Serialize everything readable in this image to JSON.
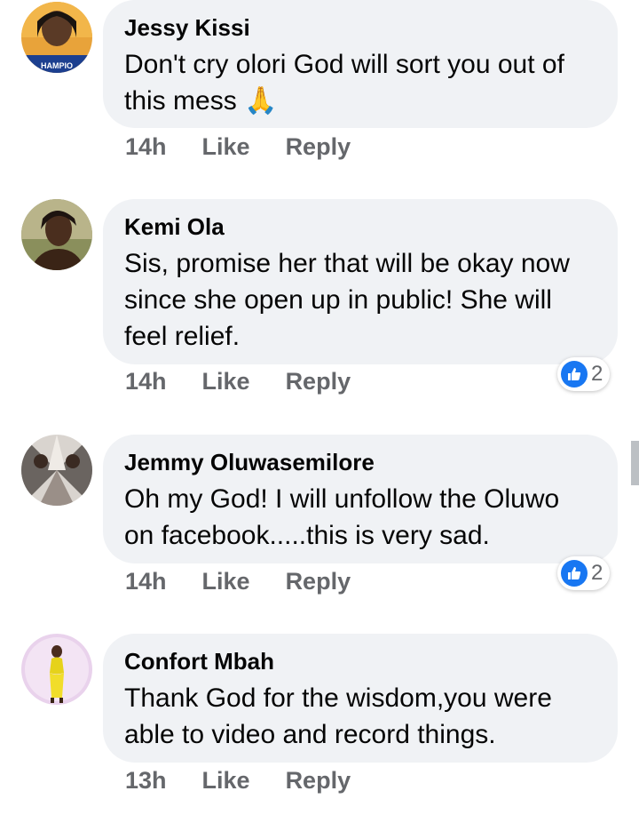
{
  "comments": [
    {
      "author": "Jessy Kissi",
      "text_lines": [
        "Don't cry olori God will sort you out of",
        "this mess 🙏"
      ],
      "time": "14h",
      "like_label": "Like",
      "reply_label": "Reply",
      "reactions": null,
      "avatar_badge_text": "HAMPIO"
    },
    {
      "author": "Kemi Ola",
      "text_lines": [
        "Sis, promise her that will be okay now",
        "since she open up in public! She will",
        "feel relief."
      ],
      "time": "14h",
      "like_label": "Like",
      "reply_label": "Reply",
      "reactions": "2"
    },
    {
      "author": "Jemmy Oluwasemilore",
      "text_lines": [
        "Oh my God! I will unfollow the Oluwo",
        "on facebook.....this is very sad."
      ],
      "time": "14h",
      "like_label": "Like",
      "reply_label": "Reply",
      "reactions": "2"
    },
    {
      "author": "Confort Mbah",
      "text_lines": [
        "Thank God for the wisdom,you were",
        "able to video and record things."
      ],
      "time": "13h",
      "like_label": "Like",
      "reply_label": "Reply",
      "reactions": null
    }
  ],
  "colors": {
    "bubble": "#f0f2f5",
    "action_text": "#65676b",
    "like_blue": "#1877f2"
  }
}
